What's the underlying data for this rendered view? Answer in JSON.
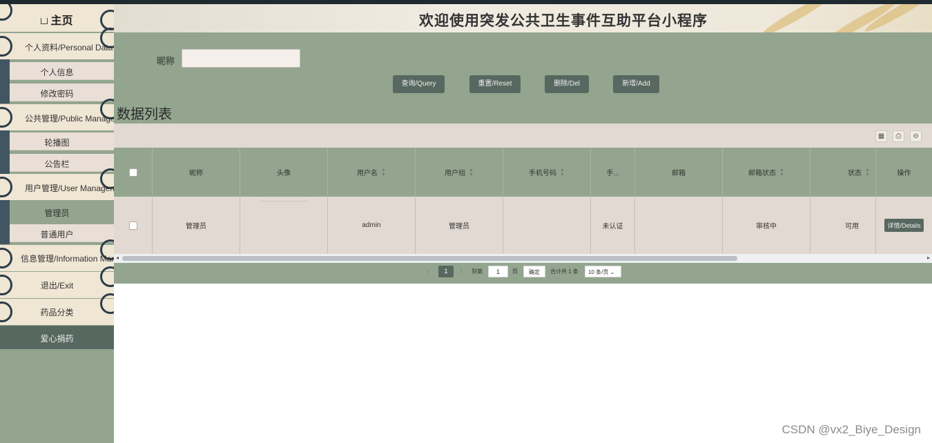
{
  "app": {
    "banner_title": "欢迎使用突发公共卫生事件互助平台小程序",
    "watermark": "CSDN @vx2_Biye_Design"
  },
  "sidebar": {
    "home_label": "主页",
    "menus": [
      {
        "label": "个人资料/Personal Data",
        "items": [
          "个人信息",
          "修改密码"
        ]
      },
      {
        "label": "公共管理/Public Management",
        "items": [
          "轮播图",
          "公告栏"
        ]
      },
      {
        "label": "用户管理/User Management",
        "items": [
          "管理员",
          "普通用户"
        ]
      },
      {
        "label": "信息管理/Information Management",
        "items": []
      },
      {
        "label": "退出/Exit",
        "items": []
      },
      {
        "label": "药品分类",
        "items": []
      },
      {
        "label": "爱心捐药",
        "items": []
      }
    ]
  },
  "search": {
    "label": "昵称",
    "value": ""
  },
  "buttons": {
    "query": "查询/Query",
    "reset": "重置/Reset",
    "delete": "删除/Del",
    "add": "新增/Add"
  },
  "list_title": "数据列表",
  "table": {
    "columns": [
      "昵称",
      "头像",
      "用户名",
      "用户组",
      "手机号码",
      "手...",
      "邮箱",
      "邮箱状态",
      "状态",
      "操作"
    ],
    "rows": [
      {
        "nickname": "管理员",
        "avatar": "",
        "username": "admin",
        "group": "管理员",
        "phone": "",
        "phone_status": "未认证",
        "email": "",
        "email_status": "审核中",
        "status": "可用",
        "action": "详情/Details"
      }
    ]
  },
  "pager": {
    "current_page": "1",
    "goto_label": "到第",
    "goto_value": "1",
    "page_unit": "页",
    "confirm": "确定",
    "total": "合计共 1 条",
    "page_size": "10 条/页"
  }
}
